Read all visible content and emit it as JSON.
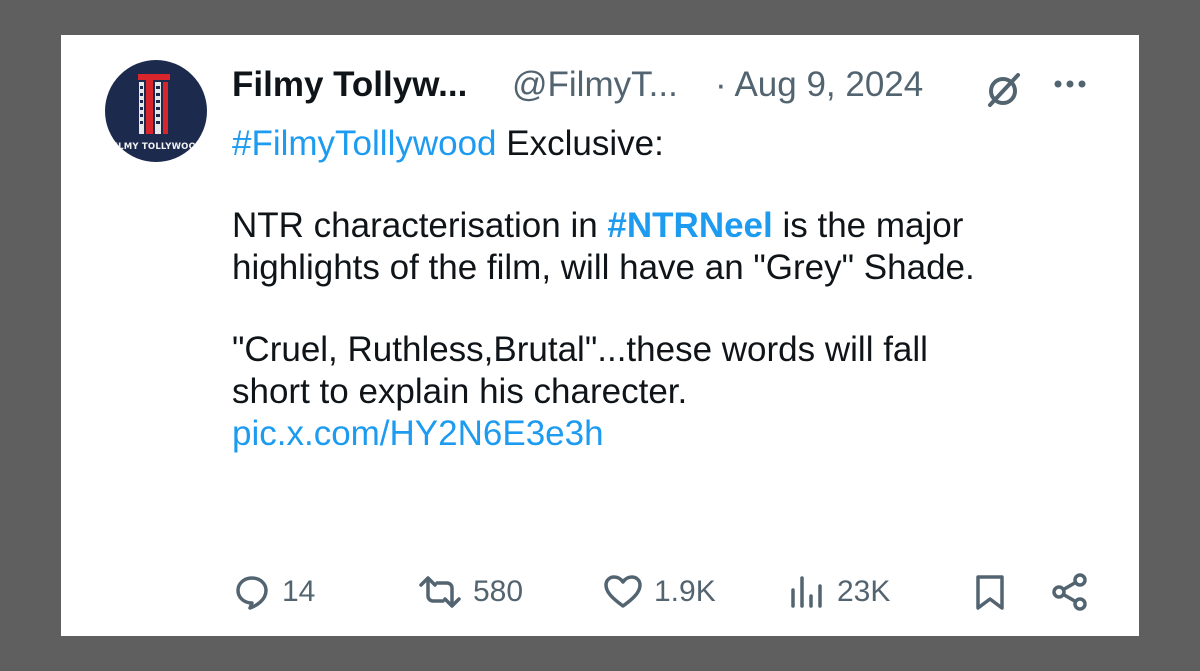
{
  "post": {
    "author_name": "Filmy Tollyw...",
    "author_handle": "@FilmyT...",
    "date": "· Aug 9, 2024",
    "avatar_text": "FILMY TOLLYWOOD",
    "lines": {
      "l1_hashtag": "#FilmyTolllywood",
      "l1_rest": " Exclusive:",
      "l2_a": "NTR characterisation in ",
      "l2_hashtag": "#NTRNeel",
      "l2_b": " is the major",
      "l3": "highlights of the film, will have an \"Grey\" Shade.",
      "l4": "\"Cruel, Ruthless,Brutal\"...these words will fall",
      "l5": "short to explain his charecter.",
      "l6_link": "pic.x.com/HY2N6E3e3h"
    },
    "stats": {
      "replies": "14",
      "reposts": "580",
      "likes": "1.9K",
      "views": "23K"
    }
  },
  "colors": {
    "link": "#1d9bf0",
    "text": "#0f1419",
    "muted": "#536471",
    "avatar_bg": "#1c2a4e",
    "logo_red": "#d9262c",
    "frame": "#5f5f5f"
  },
  "icons": [
    "grok-icon",
    "more-icon",
    "reply-icon",
    "repost-icon",
    "like-icon",
    "views-icon",
    "bookmark-icon",
    "share-icon"
  ]
}
